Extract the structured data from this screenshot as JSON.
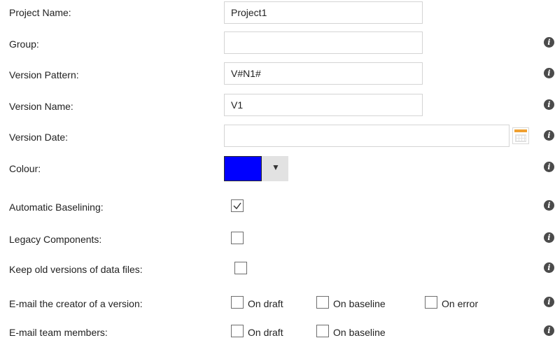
{
  "fields": {
    "project_name": {
      "label": "Project Name:",
      "value": "Project1"
    },
    "group": {
      "label": "Group:",
      "value": ""
    },
    "version_pattern": {
      "label": "Version Pattern:",
      "value": "V#N1#"
    },
    "version_name": {
      "label": "Version Name:",
      "value": "V1"
    },
    "version_date": {
      "label": "Version Date:",
      "value": ""
    },
    "colour": {
      "label": "Colour:",
      "value": "#0000ff",
      "dropdown_icon": "triangle-down-icon"
    },
    "automatic_baselining": {
      "label": "Automatic Baselining:",
      "checked": true
    },
    "legacy_components": {
      "label": "Legacy Components:",
      "checked": false
    },
    "keep_old_versions": {
      "label": "Keep old versions of data files:",
      "checked": false
    },
    "email_creator": {
      "label": "E-mail the creator of a version:",
      "options": [
        {
          "label": "On draft",
          "checked": false
        },
        {
          "label": "On baseline",
          "checked": false
        },
        {
          "label": "On error",
          "checked": false
        }
      ]
    },
    "email_team": {
      "label": "E-mail team members:",
      "options": [
        {
          "label": "On draft",
          "checked": false
        },
        {
          "label": "On baseline",
          "checked": false
        }
      ]
    }
  },
  "icons": {
    "info": "info-icon",
    "calendar": "calendar-icon"
  },
  "info_glyph": "i"
}
